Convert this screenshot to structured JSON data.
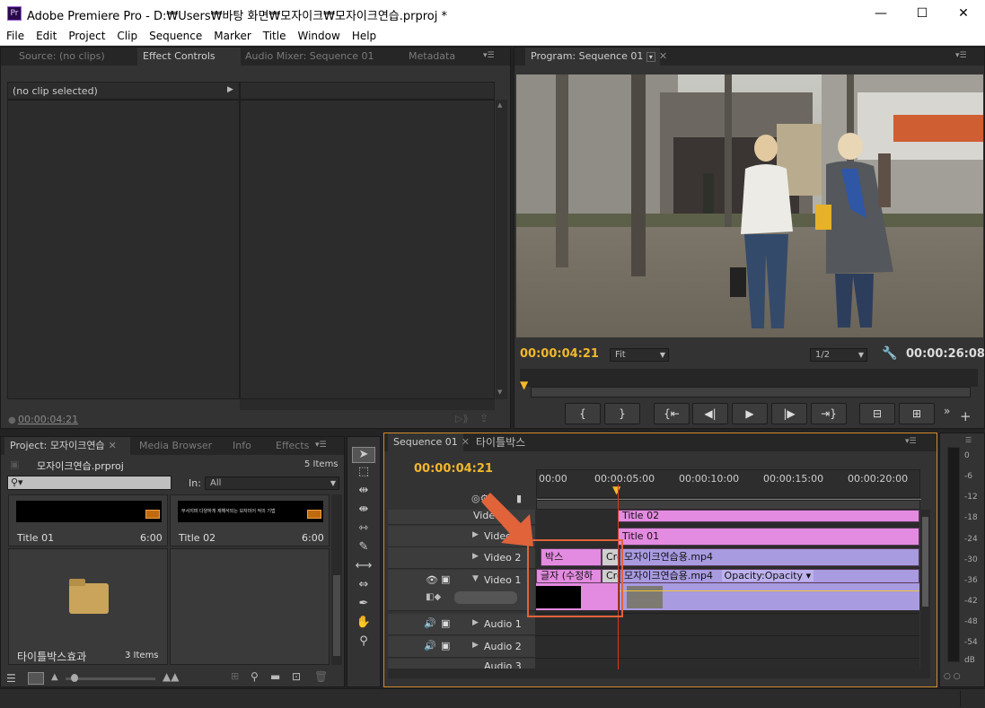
{
  "window": {
    "app_icon": "Pr",
    "title": "Adobe Premiere Pro - D:₩Users₩바탕 화면₩모자이크₩모자이크연습.prproj *",
    "minimize": "—",
    "maximize": "☐",
    "close": "✕"
  },
  "menu": [
    "File",
    "Edit",
    "Project",
    "Clip",
    "Sequence",
    "Marker",
    "Title",
    "Window",
    "Help"
  ],
  "source_panel": {
    "tabs": [
      "Source: (no clips)",
      "Effect Controls",
      "Audio Mixer: Sequence 01",
      "Metadata"
    ],
    "active_tab": "Effect Controls",
    "clip_label": "(no clip selected)",
    "timecode": "00:00:04:21"
  },
  "program_panel": {
    "tab": "Program: Sequence 01",
    "timecode_left": "00:00:04:21",
    "fit_label": "Fit",
    "resolution": "1/2",
    "timecode_right": "00:00:26:08"
  },
  "project_panel": {
    "tabs": [
      "Project: 모자이크연습",
      "Media Browser",
      "Info",
      "Effects"
    ],
    "project_file": "모자이크연습.prproj",
    "items_count": "5 Items",
    "in_label": "In:",
    "in_value": "All",
    "bins": [
      {
        "name": "Title 01",
        "duration": "6:00"
      },
      {
        "name": "Title 02",
        "duration": "6:00"
      },
      {
        "name": "타이틀박스효과",
        "duration": "3 Items"
      }
    ],
    "title02_thumb_text": "부서지며 다양하게 재해석되는 보자미어 적의 기법"
  },
  "timeline": {
    "tabs": [
      "Sequence 01",
      "타이틀박스"
    ],
    "timecode": "00:00:04:21",
    "ruler": [
      "00:00",
      "00:00:05:00",
      "00:00:10:00",
      "00:00:15:00",
      "00:00:20:00"
    ],
    "tracks": [
      {
        "name": "Video 4"
      },
      {
        "name": "Video 3"
      },
      {
        "name": "Video 2"
      },
      {
        "name": "Video 1"
      },
      {
        "name": "Audio 1"
      },
      {
        "name": "Audio 2"
      },
      {
        "name": "Audio 3"
      }
    ],
    "clips": {
      "title02": "Title 02",
      "title01": "Title 01",
      "box": "박스",
      "cross1": "Cro",
      "mp4_v2": "모자이크연습용.mp4",
      "text_clip": "글자 (수정하",
      "cross2": "Cro",
      "mp4_v1": "모자이크연습용.mp4",
      "opacity": "Opacity:Opacity"
    }
  },
  "meter": {
    "labels": [
      "0",
      "-6",
      "-12",
      "-18",
      "-24",
      "-30",
      "-36",
      "-42",
      "-48",
      "-54",
      "dB"
    ]
  },
  "colors": {
    "timecode": "#f2b72b",
    "clip_pink": "#e38be0",
    "clip_violet": "#a89be0",
    "highlight": "#e0633a"
  }
}
